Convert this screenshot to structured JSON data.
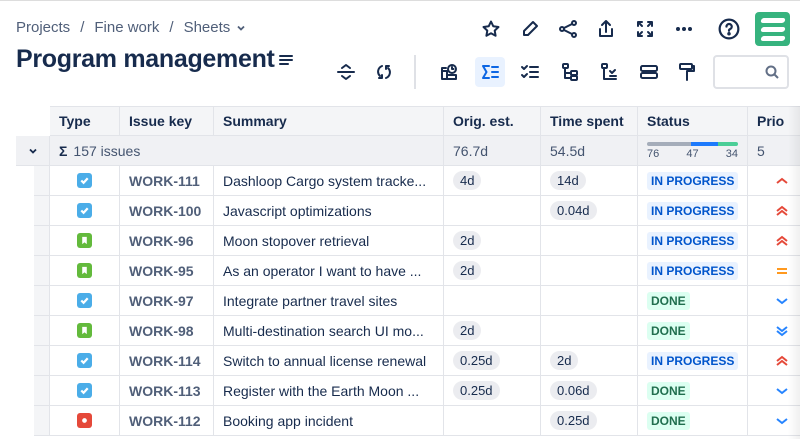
{
  "breadcrumbs": [
    "Projects",
    "Fine work",
    "Sheets"
  ],
  "title": "Program management",
  "columns": [
    "Type",
    "Issue key",
    "Summary",
    "Orig. est.",
    "Time spent",
    "Status",
    "Prio"
  ],
  "summary": {
    "count": "157 issues",
    "orig": "76.7d",
    "spent": "54.5d",
    "status_counts": [
      "76",
      "47",
      "34"
    ],
    "prio": "5"
  },
  "colors": {
    "story": "#63ba3c",
    "task": "#4bade8",
    "bug": "#e5493a",
    "accent": "#0c66e4",
    "high": "#e5493a",
    "medium": "#ff991f",
    "low": "#2684ff"
  },
  "rows": [
    {
      "type": "task",
      "key": "WORK-111",
      "summary": "Dashloop Cargo system tracke...",
      "orig": "4d",
      "spent": "14d",
      "status": "IN PROGRESS",
      "prio": "high"
    },
    {
      "type": "task",
      "key": "WORK-100",
      "summary": "Javascript optimizations",
      "orig": "",
      "spent": "0.04d",
      "status": "IN PROGRESS",
      "prio": "highest"
    },
    {
      "type": "story",
      "key": "WORK-96",
      "summary": "Moon stopover retrieval",
      "orig": "2d",
      "spent": "",
      "status": "IN PROGRESS",
      "prio": "highest"
    },
    {
      "type": "story",
      "key": "WORK-95",
      "summary": "As an operator I want to have ...",
      "orig": "2d",
      "spent": "",
      "status": "IN PROGRESS",
      "prio": "medium"
    },
    {
      "type": "task",
      "key": "WORK-97",
      "summary": "Integrate partner travel sites",
      "orig": "",
      "spent": "",
      "status": "DONE",
      "prio": "low"
    },
    {
      "type": "story",
      "key": "WORK-98",
      "summary": "Multi-destination search UI mo...",
      "orig": "2d",
      "spent": "",
      "status": "DONE",
      "prio": "lowest"
    },
    {
      "type": "task",
      "key": "WORK-114",
      "summary": "Switch to annual license renewal",
      "orig": "0.25d",
      "spent": "2d",
      "status": "IN PROGRESS",
      "prio": "highest"
    },
    {
      "type": "task",
      "key": "WORK-113",
      "summary": "Register with the Earth Moon ...",
      "orig": "0.25d",
      "spent": "0.06d",
      "status": "DONE",
      "prio": "low"
    },
    {
      "type": "bug",
      "key": "WORK-112",
      "summary": "Booking app incident",
      "orig": "",
      "spent": "0.25d",
      "status": "DONE",
      "prio": "low"
    }
  ]
}
